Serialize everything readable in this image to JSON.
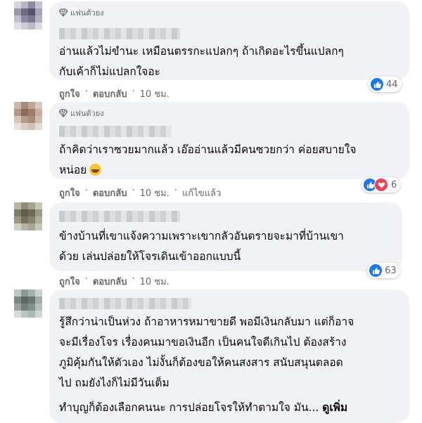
{
  "comments": [
    {
      "badge": "แฟนตัวยง",
      "lines": [
        "อ่านแล้วไม่ขำนะ เหมือนตรรกะแปลกๆ ถ้าเกิดอะไรขึ้นแปลกๆ",
        "กับเค้าก็ไม่แปลกใจอะ"
      ],
      "like": "ถูกใจ",
      "reply": "ตอบกลับ",
      "time": "10 ชม.",
      "reaction_count": "44"
    },
    {
      "badge": "แฟนตัวยง",
      "lines": [
        "ถ้าคิดว่าเราซวยมากแล้ว เอ๊ออ่านแล้วมีคนซวยกว่า ค่อยสบายใจ",
        "หน่อย"
      ],
      "like": "ถูกใจ",
      "reply": "ตอบกลับ",
      "time": "10 ชม.",
      "edited": "แก้ไขแล้ว",
      "reaction_count": "6"
    },
    {
      "lines": [
        "ข้างบ้านที่เขาแจ้งความเพราะเขากลัวอันตรายจะมาที่บ้านเขา",
        "ด้วย เล่นปล่อยให้โจรเดินเข้าออกแบบนี้"
      ],
      "like": "ถูกใจ",
      "reply": "ตอบกลับ",
      "time": "10 ชม.",
      "reaction_count": "63"
    },
    {
      "lines": [
        "รู้สึกว่าน่าเป็นห่วง ถ้าอาหารหมาขายดี พอมีเงินกลับมา แต่ก็อาจ",
        "จะมีเรื่องโจร เรื่องคนมาขอเงินอีก เป็นคนใจดีเกินไป ต้องสร้าง",
        "ภูมิคุ้มกันให้ตัวเอง ไม่งั้นก็ต้องขอให้คนสงสาร สนับสนุนตลอด",
        "ไป ถมยังไงก็ไม่มีวันเต็ม"
      ],
      "last_line": "ทำบุญก็ต้องเลือกคนนะ การปล่อยโจรให้ทำตามใจ มัน...",
      "see_more": "ดูเพิ่ม"
    }
  ],
  "separator": "·",
  "colors": {
    "like_blue": "#1877f2",
    "heart_red": "#f33e58",
    "bubble": "#f0f2f5",
    "meta": "#65676b"
  },
  "icons": {
    "badge": "diamond-icon",
    "like": "thumbs-up-icon",
    "love": "heart-icon",
    "haha": "laughing-emoji-icon"
  }
}
